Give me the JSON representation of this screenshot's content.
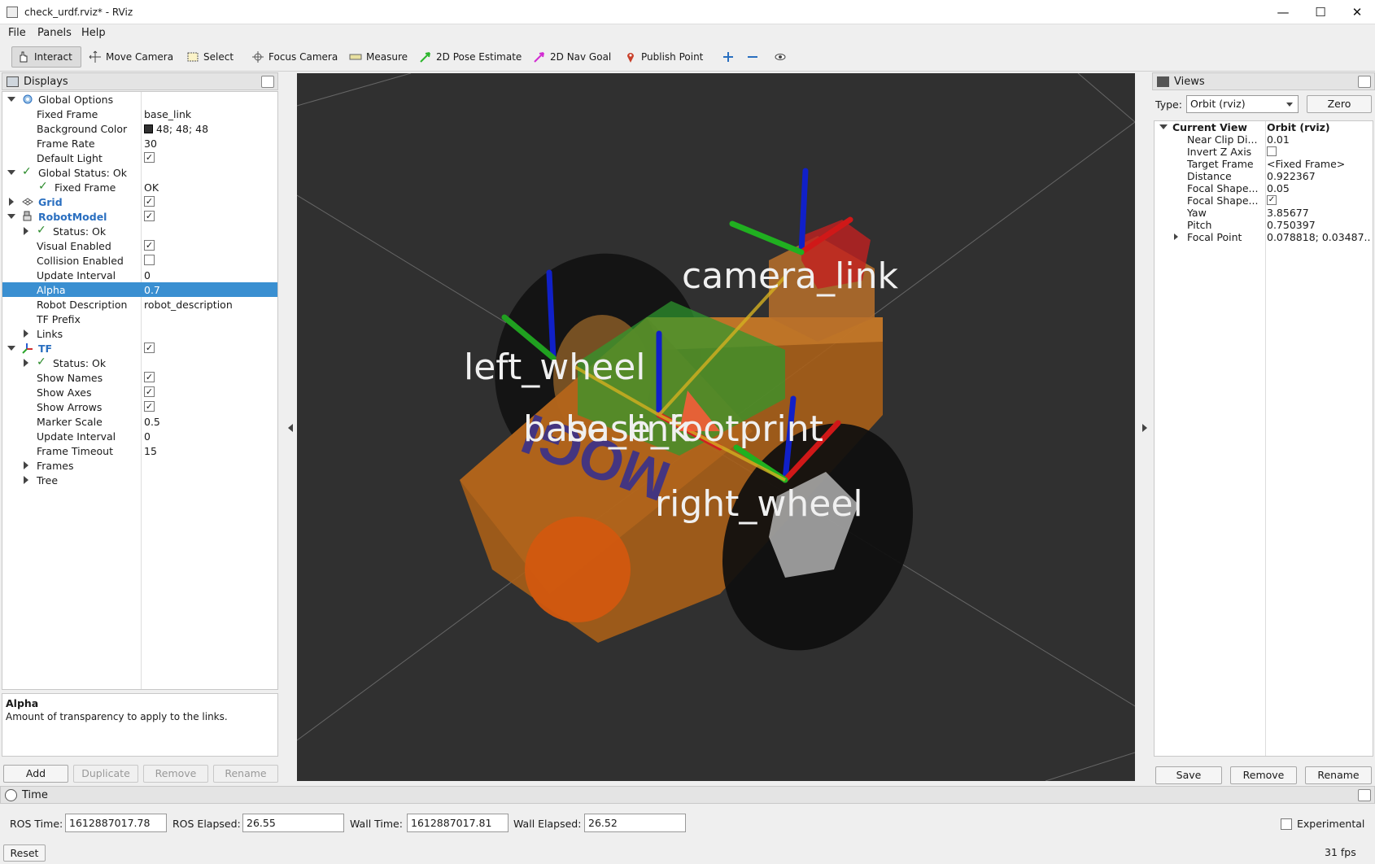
{
  "window": {
    "title": "check_urdf.rviz* - RViz"
  },
  "menu": [
    "File",
    "Panels",
    "Help"
  ],
  "toolbar": {
    "interact": "Interact",
    "move_camera": "Move Camera",
    "select": "Select",
    "focus_camera": "Focus Camera",
    "measure": "Measure",
    "pose_estimate": "2D Pose Estimate",
    "nav_goal": "2D Nav Goal",
    "publish_point": "Publish Point"
  },
  "displays": {
    "title": "Displays",
    "rows": [
      {
        "label": "Global Options",
        "value": ""
      },
      {
        "label": "Fixed Frame",
        "value": "base_link"
      },
      {
        "label": "Background Color",
        "value": "48; 48; 48"
      },
      {
        "label": "Frame Rate",
        "value": "30"
      },
      {
        "label": "Default Light",
        "value": ""
      },
      {
        "label": "Global Status: Ok",
        "value": ""
      },
      {
        "label": "Fixed Frame",
        "value": "OK"
      },
      {
        "label": "Grid",
        "value": ""
      },
      {
        "label": "RobotModel",
        "value": ""
      },
      {
        "label": "Status: Ok",
        "value": ""
      },
      {
        "label": "Visual Enabled",
        "value": ""
      },
      {
        "label": "Collision Enabled",
        "value": ""
      },
      {
        "label": "Update Interval",
        "value": "0"
      },
      {
        "label": "Alpha",
        "value": "0.7"
      },
      {
        "label": "Robot Description",
        "value": "robot_description"
      },
      {
        "label": "TF Prefix",
        "value": ""
      },
      {
        "label": "Links",
        "value": ""
      },
      {
        "label": "TF",
        "value": ""
      },
      {
        "label": "Status: Ok",
        "value": ""
      },
      {
        "label": "Show Names",
        "value": ""
      },
      {
        "label": "Show Axes",
        "value": ""
      },
      {
        "label": "Show Arrows",
        "value": ""
      },
      {
        "label": "Marker Scale",
        "value": "0.5"
      },
      {
        "label": "Update Interval",
        "value": "0"
      },
      {
        "label": "Frame Timeout",
        "value": "15"
      },
      {
        "label": "Frames",
        "value": ""
      },
      {
        "label": "Tree",
        "value": ""
      }
    ],
    "description_title": "Alpha",
    "description_text": "Amount of transparency to apply to the links.",
    "buttons": {
      "add": "Add",
      "duplicate": "Duplicate",
      "remove": "Remove",
      "rename": "Rename"
    }
  },
  "viewport": {
    "labels": {
      "camera_link": "camera_link",
      "left_wheel": "left_wheel",
      "base_link": "base_link",
      "base_footprint": "base_footprint",
      "right_wheel": "right_wheel",
      "body_text": "MOGI"
    },
    "colors": {
      "background": "#303030",
      "body": "#b5671c",
      "wheel": "#111111",
      "caster": "#d45a10",
      "green_link": "#2f9a2f"
    }
  },
  "views": {
    "title": "Views",
    "type_label": "Type:",
    "type_value": "Orbit (rviz)",
    "zero": "Zero",
    "current_view": "Current View",
    "current_view_value": "Orbit (rviz)",
    "rows": [
      {
        "label": "Near Clip Di...",
        "value": "0.01"
      },
      {
        "label": "Invert Z Axis",
        "value": ""
      },
      {
        "label": "Target Frame",
        "value": "<Fixed Frame>"
      },
      {
        "label": "Distance",
        "value": "0.922367"
      },
      {
        "label": "Focal Shape...",
        "value": "0.05"
      },
      {
        "label": "Focal Shape...",
        "value": ""
      },
      {
        "label": "Yaw",
        "value": "3.85677"
      },
      {
        "label": "Pitch",
        "value": "0.750397"
      },
      {
        "label": "Focal Point",
        "value": "0.078818; 0.03487..."
      }
    ],
    "buttons": {
      "save": "Save",
      "remove": "Remove",
      "rename": "Rename"
    }
  },
  "time": {
    "title": "Time",
    "ros_time_label": "ROS Time:",
    "ros_time": "1612887017.78",
    "ros_elapsed_label": "ROS Elapsed:",
    "ros_elapsed": "26.55",
    "wall_time_label": "Wall Time:",
    "wall_time": "1612887017.81",
    "wall_elapsed_label": "Wall Elapsed:",
    "wall_elapsed": "26.52",
    "experimental": "Experimental",
    "reset": "Reset",
    "fps": "31 fps"
  }
}
